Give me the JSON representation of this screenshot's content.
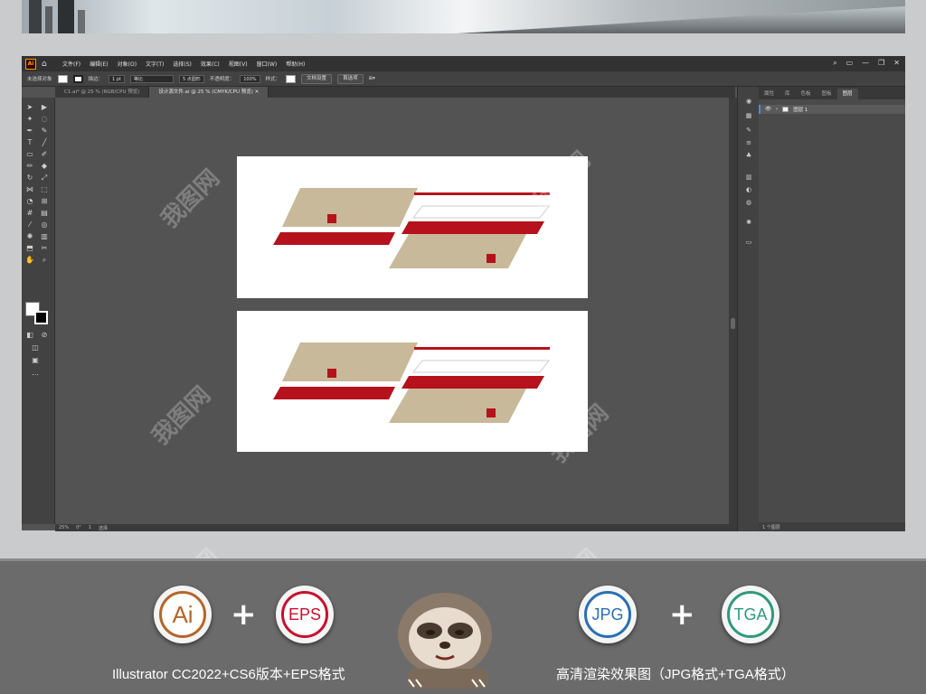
{
  "app": {
    "logo": "Ai",
    "menu": [
      "文件(F)",
      "编辑(E)",
      "对象(O)",
      "文字(T)",
      "选择(S)",
      "效果(C)",
      "视图(V)",
      "窗口(W)",
      "帮助(H)"
    ],
    "window_controls": [
      "—",
      "❐",
      "✕"
    ]
  },
  "control_bar": {
    "selection_label": "未选择对象",
    "stroke_label": "描边：",
    "stroke_value": "1 pt",
    "stroke_style": "等比",
    "brush": "5 点圆形",
    "opacity_label": "不透明度：",
    "opacity_value": "100%",
    "style_label": "样式：",
    "doc_setup": "文档设置",
    "preferences": "首选项"
  },
  "tabs": [
    {
      "label": "C1.ai* @ 25 % (RGB/CPU 预览)",
      "active": false
    },
    {
      "label": "设计源文件.ai @ 25 % (CMYK/CPU 预览)  ✕",
      "active": true
    }
  ],
  "statusbar": {
    "zoom": "25%",
    "rotation": "0°",
    "artboard": "1",
    "tool": "选择"
  },
  "panel": {
    "tabs": [
      "属性",
      "库",
      "色板",
      "图板",
      "图层"
    ],
    "active_tab": "图层",
    "layer_name": "图层 1",
    "layer_count": "1 个图层"
  },
  "promo": {
    "badges": [
      "Ai",
      "EPS",
      "JPG",
      "TGA"
    ],
    "badge_colors": {
      "Ai": "#b5662a",
      "EPS": "#c8102e",
      "JPG": "#2a6fb5",
      "TGA": "#2e9a7c"
    },
    "plus": "+",
    "caption_left": "Illustrator CC2022+CS6版本+EPS格式",
    "caption_right": "高清渲染效果图（JPG格式+TGA格式）"
  },
  "watermark": "我图网"
}
